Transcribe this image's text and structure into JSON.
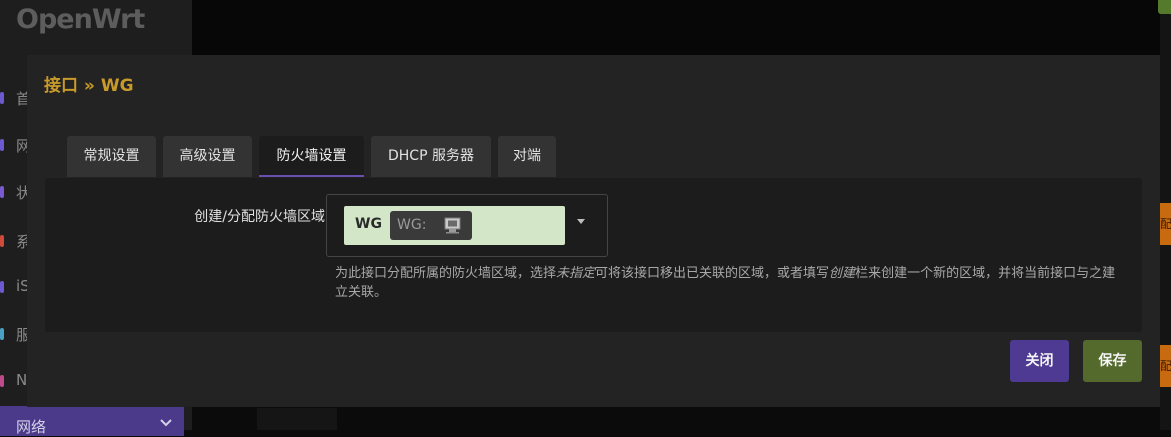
{
  "app": {
    "logo": "OpenWrt",
    "sidebar_items": [
      {
        "label": "首",
        "color": "#6b5ad0"
      },
      {
        "label": "网",
        "color": "#6b5ad0"
      },
      {
        "label": "状",
        "color": "#7a5ad0"
      },
      {
        "label": "系",
        "color": "#d04a3a"
      },
      {
        "label": "iS",
        "color": "#6b5ad0"
      },
      {
        "label": "服",
        "color": "#4aa0c0"
      },
      {
        "label": "N",
        "color": "#c04a8a"
      }
    ],
    "sidebar_active": {
      "label": "网络",
      "icon": "chevron-down-icon"
    },
    "right_tags": [
      "配",
      "配"
    ]
  },
  "modal": {
    "title": "接口 » WG",
    "tabs": [
      {
        "label": "常规设置",
        "active": false
      },
      {
        "label": "高级设置",
        "active": false
      },
      {
        "label": "防火墙设置",
        "active": true
      },
      {
        "label": "DHCP 服务器",
        "active": false
      },
      {
        "label": "对端",
        "active": false
      }
    ],
    "firewall_zone": {
      "label": "创建/分配防火墙区域",
      "zone_name": "WG",
      "interface_badge": "WG:",
      "interface_icon": "network-port-icon",
      "zone_color": "#d3e6c8",
      "help_parts": [
        "为此接口分配所属的防火墙区域，选择",
        "未指定",
        "可将该接口移出已关联的区域，或者填写",
        "创建",
        "栏来创建一个新的区域，并将当前接口与之建立关联。"
      ]
    },
    "buttons": {
      "close": "关闭",
      "save": "保存"
    }
  },
  "colors": {
    "title": "#c89a2a",
    "accent": "#4e3a93",
    "save": "#546a2c"
  }
}
